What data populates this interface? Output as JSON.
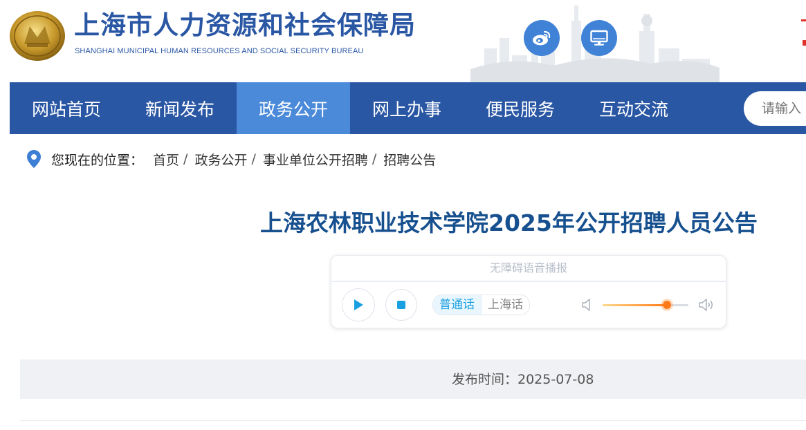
{
  "header": {
    "title": "上海市人力资源和社会保障局",
    "subtitle": "SHANGHAI MUNICIPAL HUMAN RESOURCES AND SOCIAL SECURITY BUREAU",
    "social_icons": [
      "weibo-icon",
      "computer-icon"
    ]
  },
  "nav": {
    "items": [
      {
        "label": "网站首页"
      },
      {
        "label": "新闻发布"
      },
      {
        "label": "政务公开",
        "active": true
      },
      {
        "label": "网上办事"
      },
      {
        "label": "便民服务"
      },
      {
        "label": "互动交流"
      }
    ],
    "search_placeholder": "请输入"
  },
  "breadcrumb": {
    "label": "您现在的位置：",
    "items": [
      "首页",
      "政务公开",
      "事业单位公开招聘",
      "招聘公告"
    ],
    "separator": "/"
  },
  "article": {
    "title": "上海农林职业技术学院2025年公开招聘人员公告",
    "publish_label": "发布时间：2025-07-08"
  },
  "player": {
    "header": "无障碍语音播报",
    "languages": [
      "普通话",
      "上海话"
    ],
    "active_language": "普通话",
    "volume": 0.75
  },
  "colors": {
    "brand_blue": "#2a57a4",
    "nav_active": "#4a8ad9",
    "title_blue": "#17508f",
    "accent_cyan": "#1aa0e0",
    "volume_orange": "#ff7a18"
  }
}
